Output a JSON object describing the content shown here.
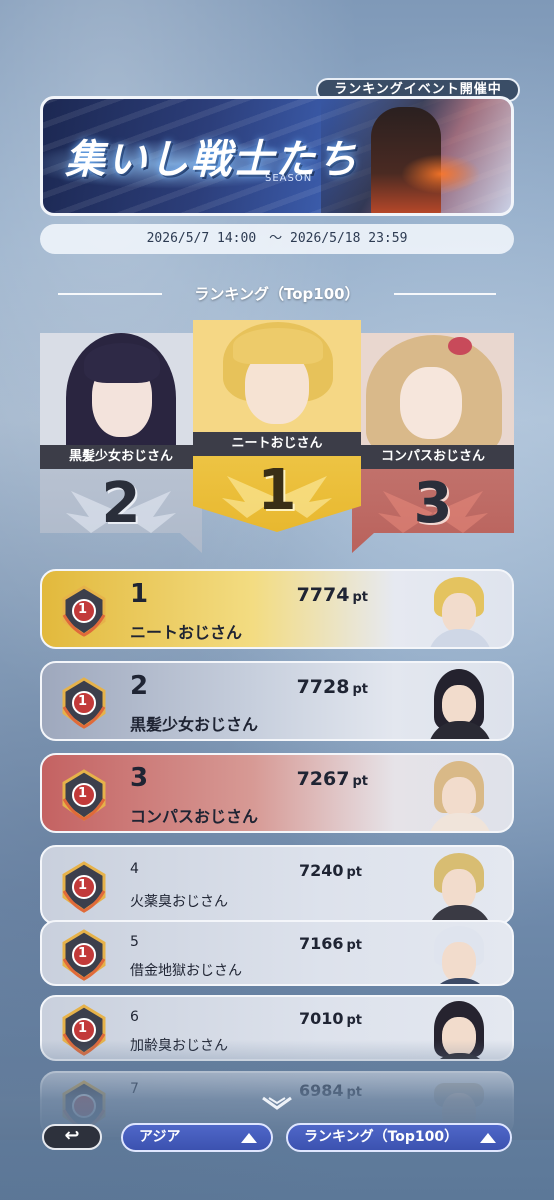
{
  "event_status": "ランキングイベント開催中",
  "banner": {
    "title": "集いし戦士たち",
    "subtitle": "SEASON"
  },
  "period": "2026/5/7 14:00　～ 2026/5/18 23:59",
  "section_title": "ランキング（Top100）",
  "podium": [
    {
      "rank": "2",
      "name": "黒髪少女おじさん"
    },
    {
      "rank": "1",
      "name": "ニートおじさん"
    },
    {
      "rank": "3",
      "name": "コンパスおじさん"
    }
  ],
  "rankings": [
    {
      "rank": "1",
      "points": "7774",
      "unit": "pt",
      "name": "ニートおじさん"
    },
    {
      "rank": "2",
      "points": "7728",
      "unit": "pt",
      "name": "黒髪少女おじさん"
    },
    {
      "rank": "3",
      "points": "7267",
      "unit": "pt",
      "name": "コンパスおじさん"
    },
    {
      "rank": "4",
      "points": "7240",
      "unit": "pt",
      "name": "火薬臭おじさん"
    },
    {
      "rank": "5",
      "points": "7166",
      "unit": "pt",
      "name": "借金地獄おじさん"
    },
    {
      "rank": "6",
      "points": "7010",
      "unit": "pt",
      "name": "加齢臭おじさん"
    },
    {
      "rank": "7",
      "points": "6984",
      "unit": "pt",
      "name": ""
    }
  ],
  "medal_label": "1",
  "footer": {
    "back_glyph": "↩",
    "region_label": "アジア",
    "mode_label": "ランキング（Top100）"
  },
  "colors": {
    "gold": "#f0c94a",
    "silver": "#c9d3e2",
    "bronze": "#c9706c",
    "button_blue": "#4459bd"
  }
}
